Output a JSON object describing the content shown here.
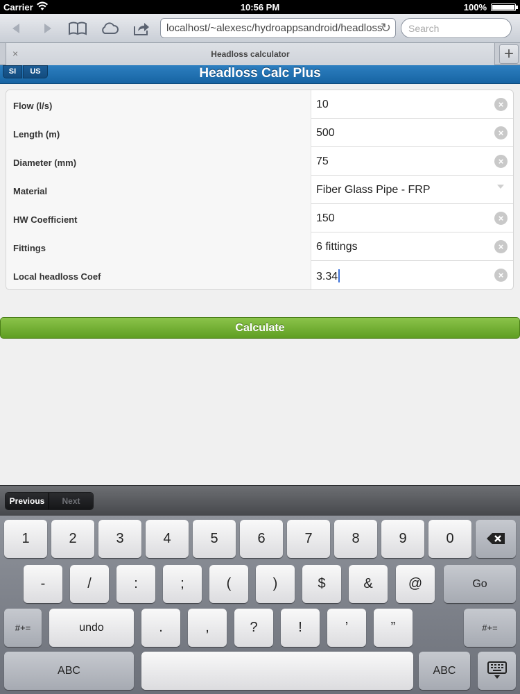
{
  "status_bar": {
    "carrier": "Carrier",
    "time": "10:56 PM",
    "battery": "100%",
    "battery_level": 1.0
  },
  "browser": {
    "url": "localhost/~alexesc/hydroappsandroid/headloss",
    "search_placeholder": "Search",
    "tab_title": "Headloss calculator",
    "tab_close": "×",
    "new_tab": "+"
  },
  "app": {
    "title": "Headloss Calc Plus",
    "units": {
      "si": "SI",
      "us": "US"
    }
  },
  "form": {
    "rows": [
      {
        "label": "Flow (l/s)",
        "value": "10"
      },
      {
        "label": "Length (m)",
        "value": "500"
      },
      {
        "label": "Diameter (mm)",
        "value": "75"
      },
      {
        "label": "Material",
        "value": "Fiber Glass Pipe - FRP"
      },
      {
        "label": "HW Coefficient",
        "value": "150"
      },
      {
        "label": "Fittings",
        "value": "6 fittings"
      },
      {
        "label": "Local headloss Coef",
        "value": "3.34"
      }
    ],
    "calculate_label": "Calculate"
  },
  "accessory": {
    "previous": "Previous",
    "next": "Next"
  },
  "keyboard": {
    "row1": [
      "1",
      "2",
      "3",
      "4",
      "5",
      "6",
      "7",
      "8",
      "9",
      "0"
    ],
    "row2": [
      "-",
      "/",
      ":",
      ";",
      "(",
      ")",
      "$",
      "&",
      "@"
    ],
    "go": "Go",
    "row3_left": "#+=",
    "undo": "undo",
    "row3": [
      ".",
      ",",
      "?",
      "!",
      "’",
      "”"
    ],
    "row3_right": "#+=",
    "abc_left": "ABC",
    "abc_right": "ABC"
  }
}
